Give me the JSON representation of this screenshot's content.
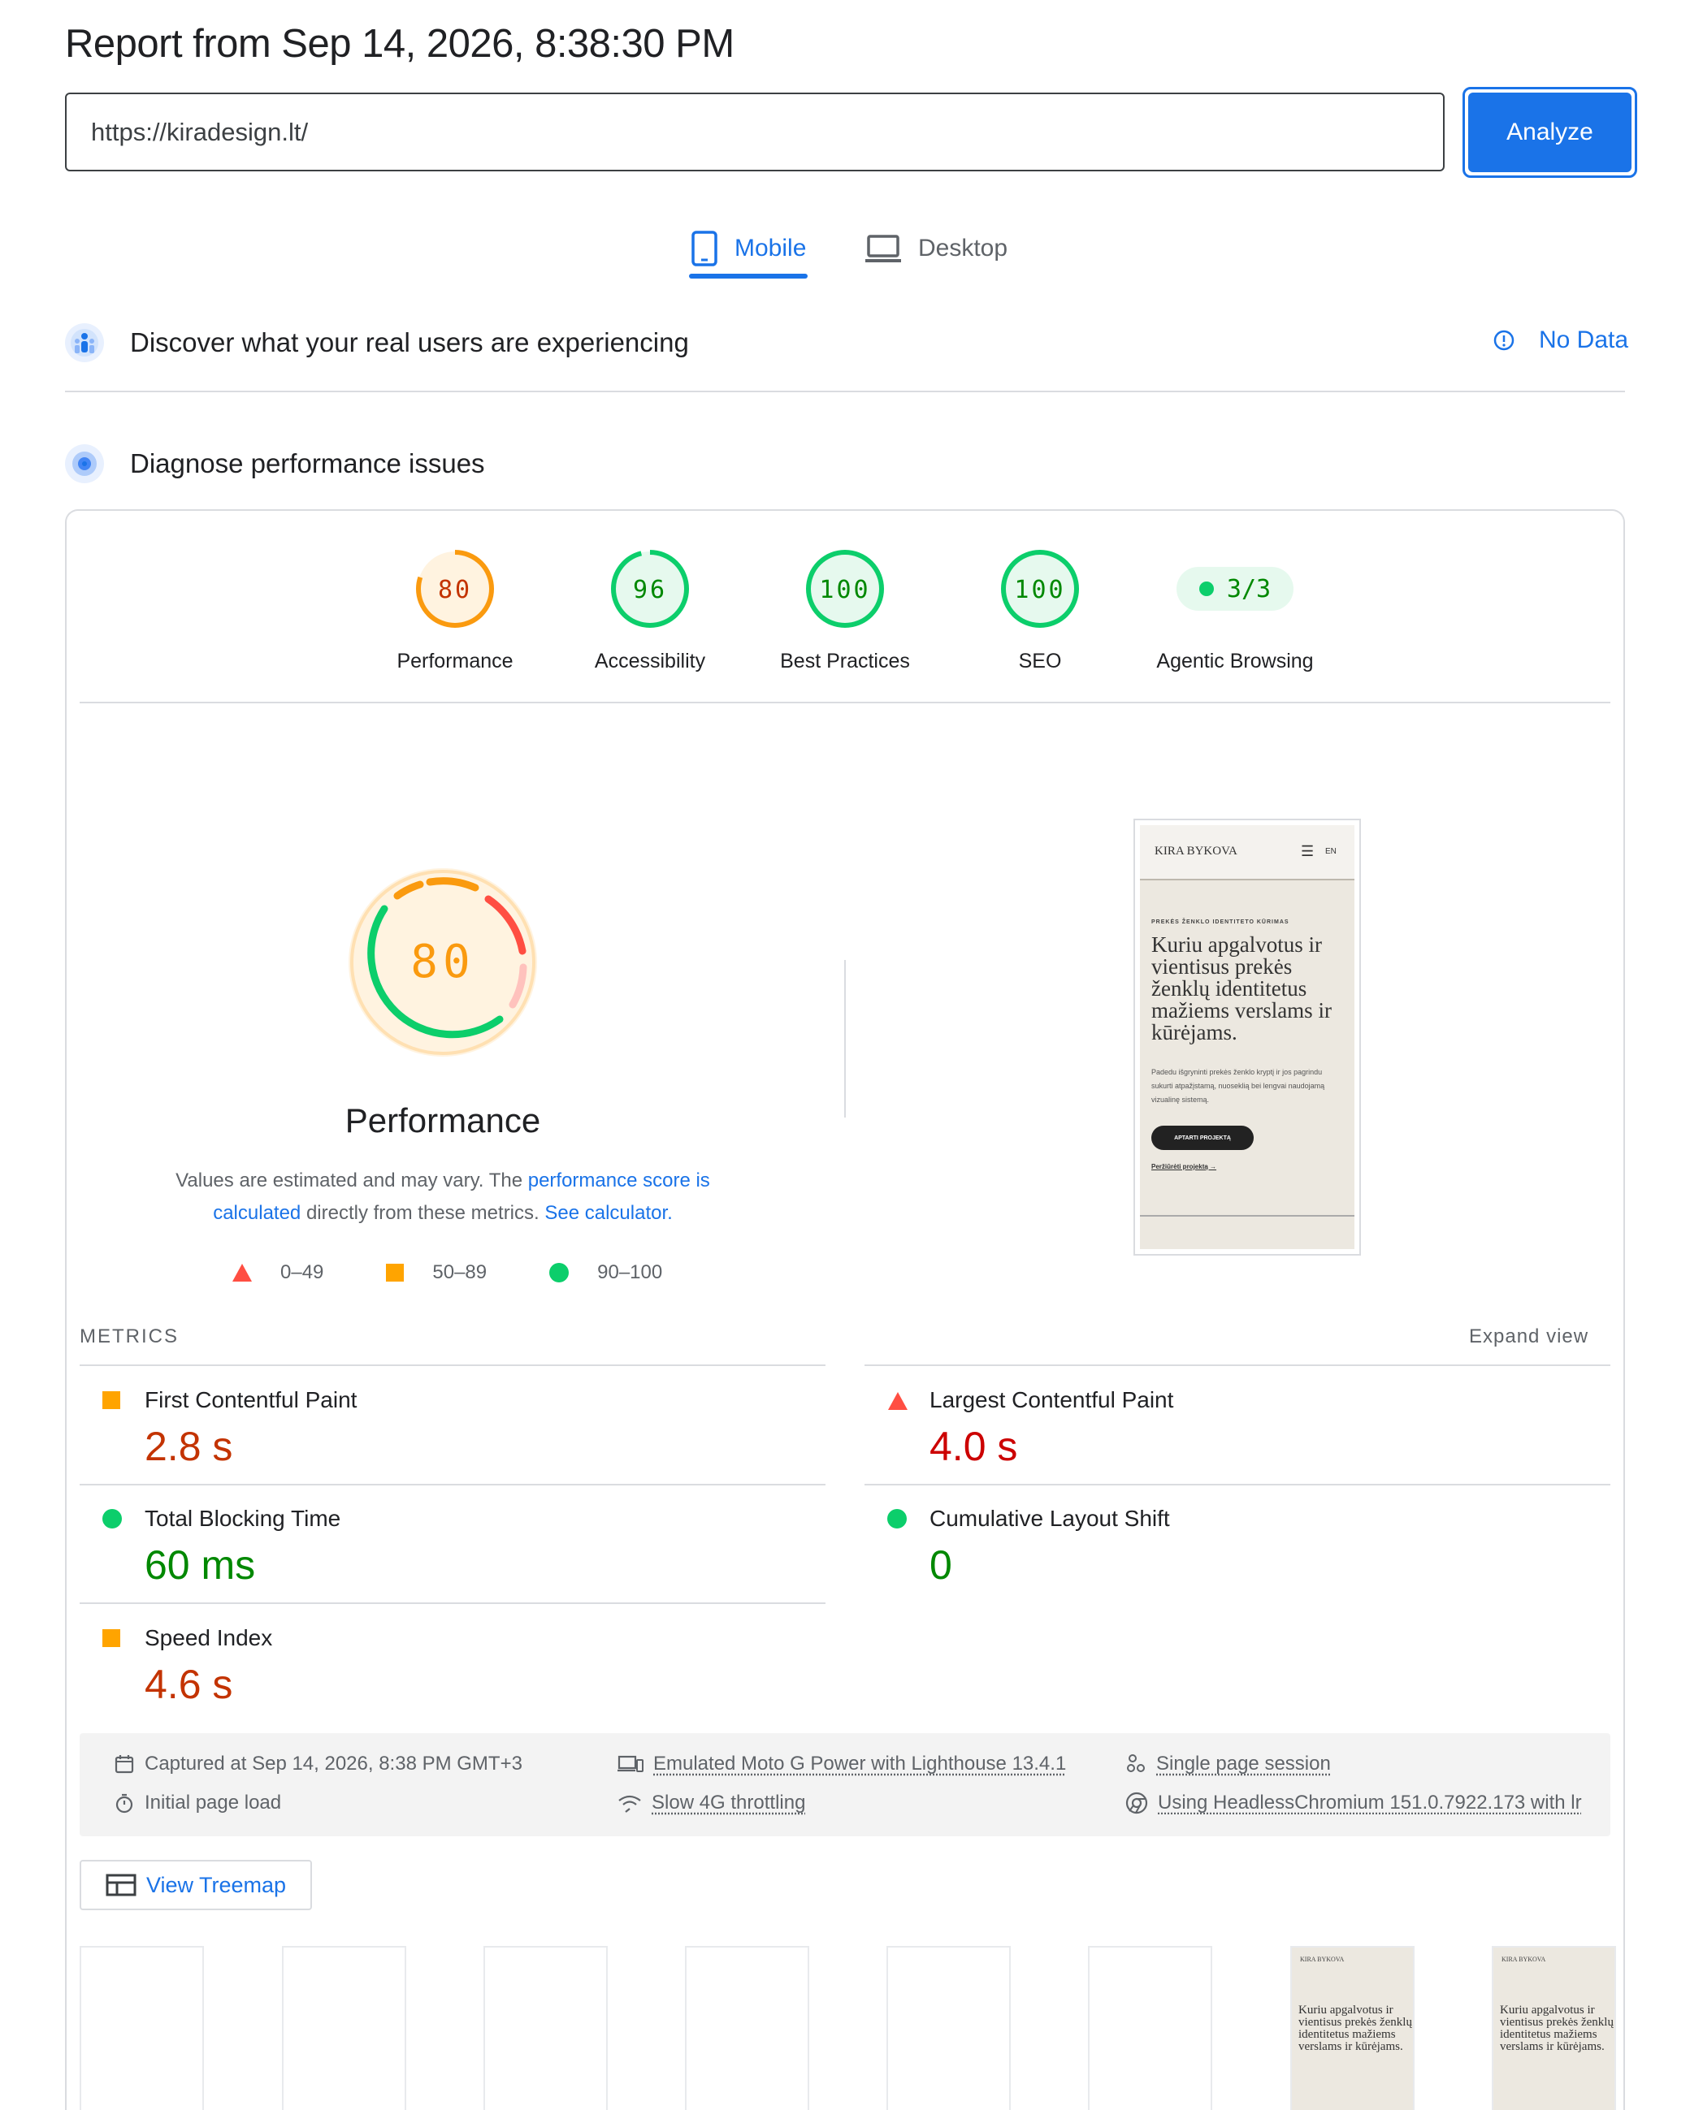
{
  "header": {
    "title": "Report from Sep 14, 2026, 8:38:30 PM",
    "url_value": "https://kiradesign.lt/",
    "analyze_label": "Analyze"
  },
  "tabs": [
    {
      "label": "Mobile",
      "icon": "phone-icon",
      "active": true
    },
    {
      "label": "Desktop",
      "icon": "laptop-icon",
      "active": false
    }
  ],
  "field_data": {
    "heading": "Discover what your real users are experiencing",
    "status_label": "No Data"
  },
  "diagnose": {
    "heading": "Diagnose performance issues"
  },
  "category_gauges": [
    {
      "label": "Performance",
      "score": "80",
      "color": "#fa9a0f"
    },
    {
      "label": "Accessibility",
      "score": "96",
      "color": "#0cce6b"
    },
    {
      "label": "Best Practices",
      "score": "100",
      "color": "#0cce6b"
    },
    {
      "label": "SEO",
      "score": "100",
      "color": "#0cce6b"
    },
    {
      "label": "Agentic Browsing",
      "score": "3/3",
      "color": "#0cce6b"
    }
  ],
  "performance": {
    "score": "80",
    "title": "Performance",
    "desc_prefix": "Values are estimated and may vary. The ",
    "desc_link1": "performance score is calculated",
    "desc_mid": " directly from these metrics. ",
    "desc_link2": "See calculator.",
    "legend": [
      {
        "range": "0–49",
        "shape": "triangle",
        "color": "#ff4e42"
      },
      {
        "range": "50–89",
        "shape": "square",
        "color": "#ffa400"
      },
      {
        "range": "90–100",
        "shape": "circle",
        "color": "#0cce6b"
      }
    ]
  },
  "screenshot": {
    "brand": "KIRA BYKOVA",
    "lang": "EN",
    "eyebrow": "PREKĖS ŽENKLO IDENTITETO KŪRIMAS",
    "headline": "Kuriu apgalvotus ir vientisus prekės ženklų identitetus mažiems verslams ir kūrėjams.",
    "body": "Padedu išgryninti prekės ženklo kryptį ir jos pagrindu sukurti atpažįstamą, nuoseklią bei lengvai naudojamą vizualinę sistemą.",
    "cta": "APTARTI PROJEKTĄ",
    "secondary": "Peržiūrėti projektą →"
  },
  "metrics": {
    "heading": "METRICS",
    "expand_label": "Expand view",
    "items": [
      {
        "name": "First Contentful Paint",
        "value": "2.8 s",
        "rating": "average"
      },
      {
        "name": "Largest Contentful Paint",
        "value": "4.0 s",
        "rating": "fail"
      },
      {
        "name": "Total Blocking Time",
        "value": "60 ms",
        "rating": "pass"
      },
      {
        "name": "Cumulative Layout Shift",
        "value": "0",
        "rating": "pass"
      },
      {
        "name": "Speed Index",
        "value": "4.6 s",
        "rating": "average"
      }
    ]
  },
  "run_info": {
    "captured": "Captured at Sep 14, 2026, 8:38 PM GMT+3",
    "load": "Initial page load",
    "device": "Emulated Moto G Power with Lighthouse 13.4.1",
    "throttling": "Slow 4G throttling",
    "session": "Single page session",
    "browser": "Using HeadlessChromium 151.0.7922.173 with lr"
  },
  "treemap_label": "View Treemap",
  "colors": {
    "accent": "#1a73e8",
    "pass": "#0cce6b",
    "average": "#ffa400",
    "fail": "#ff4e42",
    "pass_text": "#008800",
    "average_text": "#c33300",
    "fail_text": "#cc0000"
  }
}
